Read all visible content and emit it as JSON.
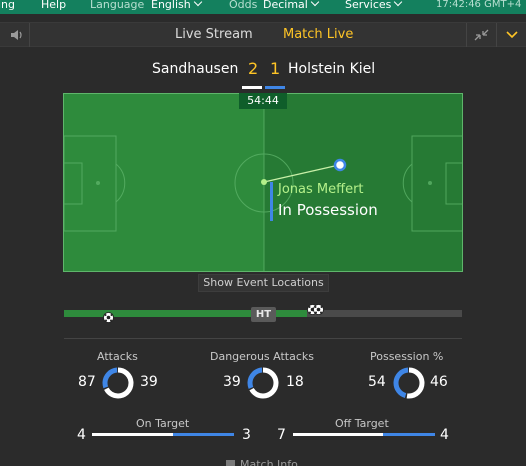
{
  "topnav": {
    "item1": "ing",
    "help": "Help",
    "language_label": "Language",
    "language_value": "English",
    "odds_label": "Odds",
    "odds_value": "Decimal",
    "services": "Services",
    "time": "17:42:46 GMT+4"
  },
  "tabs": {
    "live_stream": "Live Stream",
    "match_live": "Match Live"
  },
  "match": {
    "home_team": "Sandhausen",
    "away_team": "Holstein Kiel",
    "home_score": "2",
    "away_score": "1",
    "clock": "54:44",
    "possession_player": "Jonas Meffert",
    "possession_text": "In Possession",
    "home_color": "#ffffff",
    "away_color": "#3f86e6"
  },
  "show_events_label": "Show Event Locations",
  "timeline": {
    "ht_label": "HT",
    "progress_fraction": 0.61,
    "ball_icon": "football-icon"
  },
  "stats": {
    "attacks": {
      "label": "Attacks",
      "home": 87,
      "away": 39
    },
    "dangerous": {
      "label": "Dangerous Attacks",
      "home": 39,
      "away": 18
    },
    "possession": {
      "label": "Possession %",
      "home": 54,
      "away": 46
    },
    "on_target": {
      "label": "On Target",
      "home": 4,
      "away": 3
    },
    "off_target": {
      "label": "Off Target",
      "home": 7,
      "away": 4
    }
  },
  "match_info_label": "Match Info",
  "colors": {
    "accent": "#ffc526",
    "home": "#ffffff",
    "away": "#3f86e6",
    "pitch": "#2e8b3c"
  }
}
